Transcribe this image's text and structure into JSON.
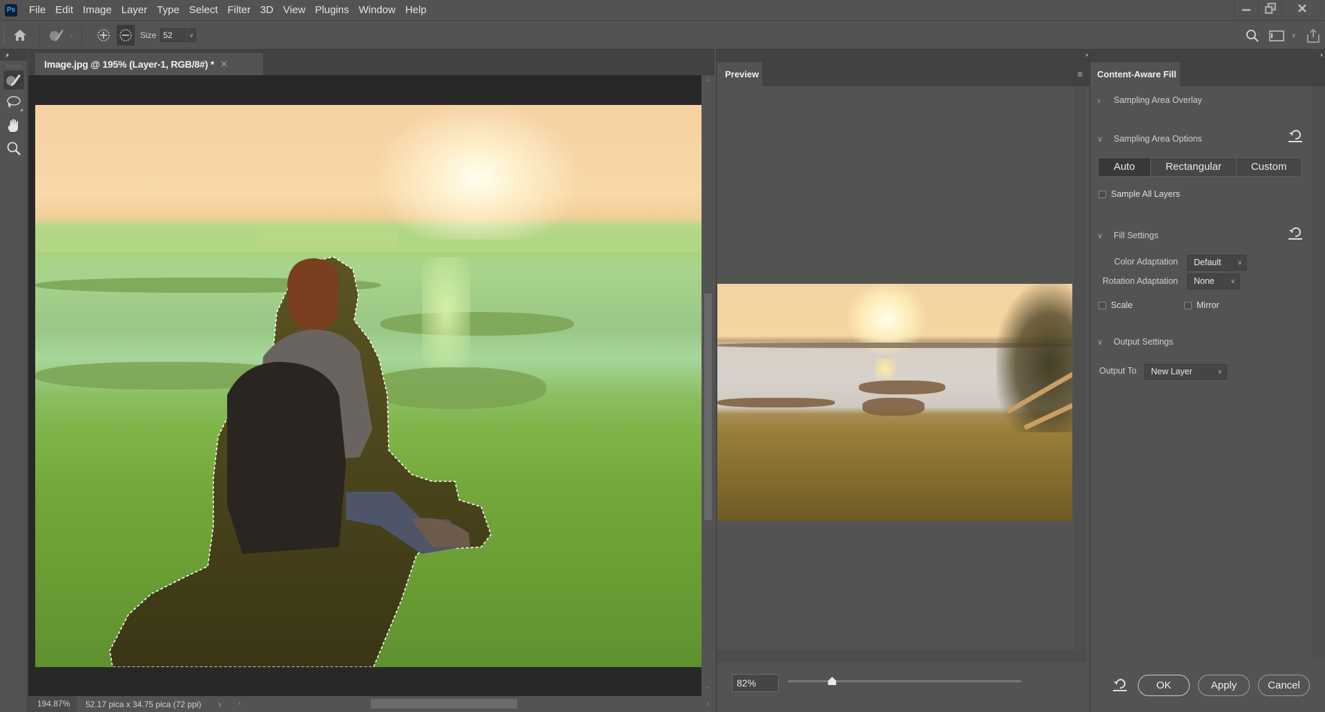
{
  "app": {
    "logo": "Ps",
    "menu": [
      "File",
      "Edit",
      "Image",
      "Layer",
      "Type",
      "Select",
      "Filter",
      "3D",
      "View",
      "Plugins",
      "Window",
      "Help"
    ],
    "window_controls": {
      "minimize": "minimize-icon",
      "restore": "restore-icon",
      "close": "close-icon"
    }
  },
  "options_bar": {
    "home_icon": "home-icon",
    "tool_preset_icon": "brush-icon",
    "add_mode_icon": "add-to-selection-icon",
    "subtract_mode_icon": "subtract-from-selection-icon",
    "size_label": "Size",
    "size_value": "52",
    "right_icons": [
      "search-icon",
      "workspace-icon",
      "share-icon"
    ]
  },
  "toolbar": {
    "tools": [
      {
        "name": "sampling-brush",
        "icon": "brush-icon",
        "active": true
      },
      {
        "name": "lasso",
        "icon": "lasso-icon",
        "active": false
      },
      {
        "name": "hand",
        "icon": "hand-icon",
        "active": false
      },
      {
        "name": "zoom",
        "icon": "zoom-icon",
        "active": false
      }
    ]
  },
  "document": {
    "tab_title": "Image.jpg @ 195% (Layer-1, RGB/8#) *",
    "status_zoom": "194.87%",
    "status_size": "52.17 pica x 34.75 pica (72 ppi)"
  },
  "preview": {
    "tab_label": "Preview",
    "zoom_value": "82%",
    "zoom_slider_fraction": 0.19
  },
  "content_aware_fill": {
    "tab_label": "Content-Aware Fill",
    "sampling_area_overlay": {
      "label": "Sampling Area Overlay",
      "expanded": false
    },
    "sampling_area_options": {
      "label": "Sampling Area Options",
      "expanded": true,
      "modes": [
        "Auto",
        "Rectangular",
        "Custom"
      ],
      "selected_mode": "Auto",
      "sample_all_layers_label": "Sample All Layers",
      "sample_all_layers": false
    },
    "fill_settings": {
      "label": "Fill Settings",
      "expanded": true,
      "color_adaptation_label": "Color Adaptation",
      "color_adaptation_value": "Default",
      "rotation_adaptation_label": "Rotation Adaptation",
      "rotation_adaptation_value": "None",
      "scale_label": "Scale",
      "scale": false,
      "mirror_label": "Mirror",
      "mirror": false
    },
    "output_settings": {
      "label": "Output Settings",
      "expanded": true,
      "output_to_label": "Output To",
      "output_to_value": "New Layer"
    },
    "buttons": {
      "ok": "OK",
      "apply": "Apply",
      "cancel": "Cancel"
    }
  }
}
